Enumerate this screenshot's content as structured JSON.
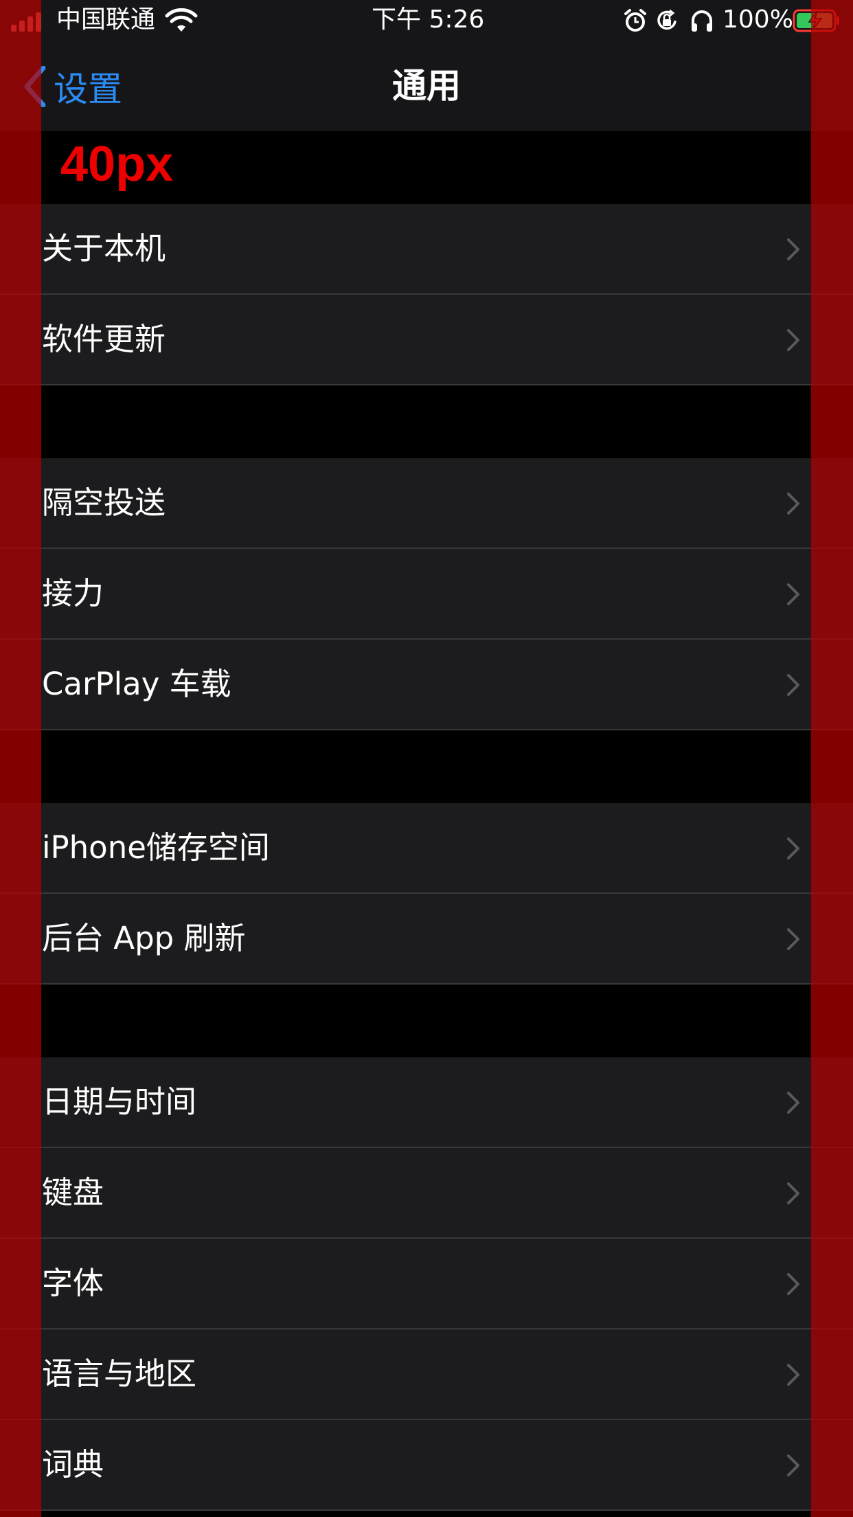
{
  "status_bar": {
    "carrier": "中国联通",
    "time": "下午 5:26",
    "battery": "100%",
    "icons": [
      "signal-icon",
      "wifi-icon",
      "alarm-icon",
      "orientation-lock-icon",
      "headphones-icon",
      "battery-charging-icon"
    ]
  },
  "nav": {
    "back_label": "设置",
    "title": "通用"
  },
  "annotation": {
    "label": "40px",
    "color": "#ee0000"
  },
  "groups": [
    {
      "items": [
        {
          "label": "关于本机"
        },
        {
          "label": "软件更新"
        }
      ]
    },
    {
      "items": [
        {
          "label": "隔空投送"
        },
        {
          "label": "接力"
        },
        {
          "label": "CarPlay 车载"
        }
      ]
    },
    {
      "items": [
        {
          "label": "iPhone储存空间"
        },
        {
          "label": "后台 App 刷新"
        }
      ]
    },
    {
      "items": [
        {
          "label": "日期与时间"
        },
        {
          "label": "键盘"
        },
        {
          "label": "字体"
        },
        {
          "label": "语言与地区"
        },
        {
          "label": "词典"
        }
      ]
    }
  ],
  "colors": {
    "accent": "#2b8bf5",
    "row_background": "#1c1c1e",
    "separator": "#38383a",
    "chevron": "#5a5a5e",
    "battery_fill": "#34c759"
  }
}
